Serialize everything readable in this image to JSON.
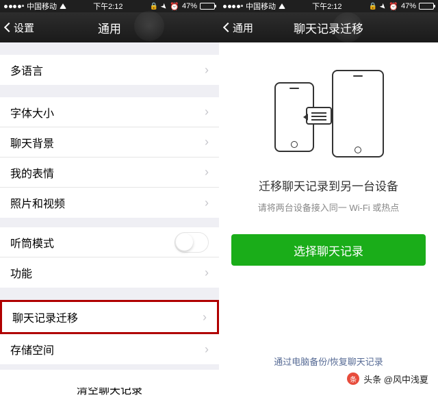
{
  "status": {
    "carrier": "中国移动",
    "time": "下午2:12",
    "battery_pct": "47%",
    "alarm": "⏰",
    "location": "➤",
    "lock": "🔒"
  },
  "left": {
    "back": "设置",
    "title": "通用",
    "rows": {
      "multilang": "多语言",
      "fontsize": "字体大小",
      "chatbg": "聊天背景",
      "stickers": "我的表情",
      "photovideo": "照片和视频",
      "earpiece": "听筒模式",
      "features": "功能",
      "migrate": "聊天记录迁移",
      "storage": "存储空间",
      "clear": "清空聊天记录"
    }
  },
  "right": {
    "back": "通用",
    "title": "聊天记录迁移",
    "heading": "迁移聊天记录到另一台设备",
    "subheading": "请将两台设备接入同一 Wi-Fi 或热点",
    "button": "选择聊天记录",
    "link": "通过电脑备份/恢复聊天记录"
  },
  "footer": {
    "source": "头条 @风中浅夏"
  }
}
